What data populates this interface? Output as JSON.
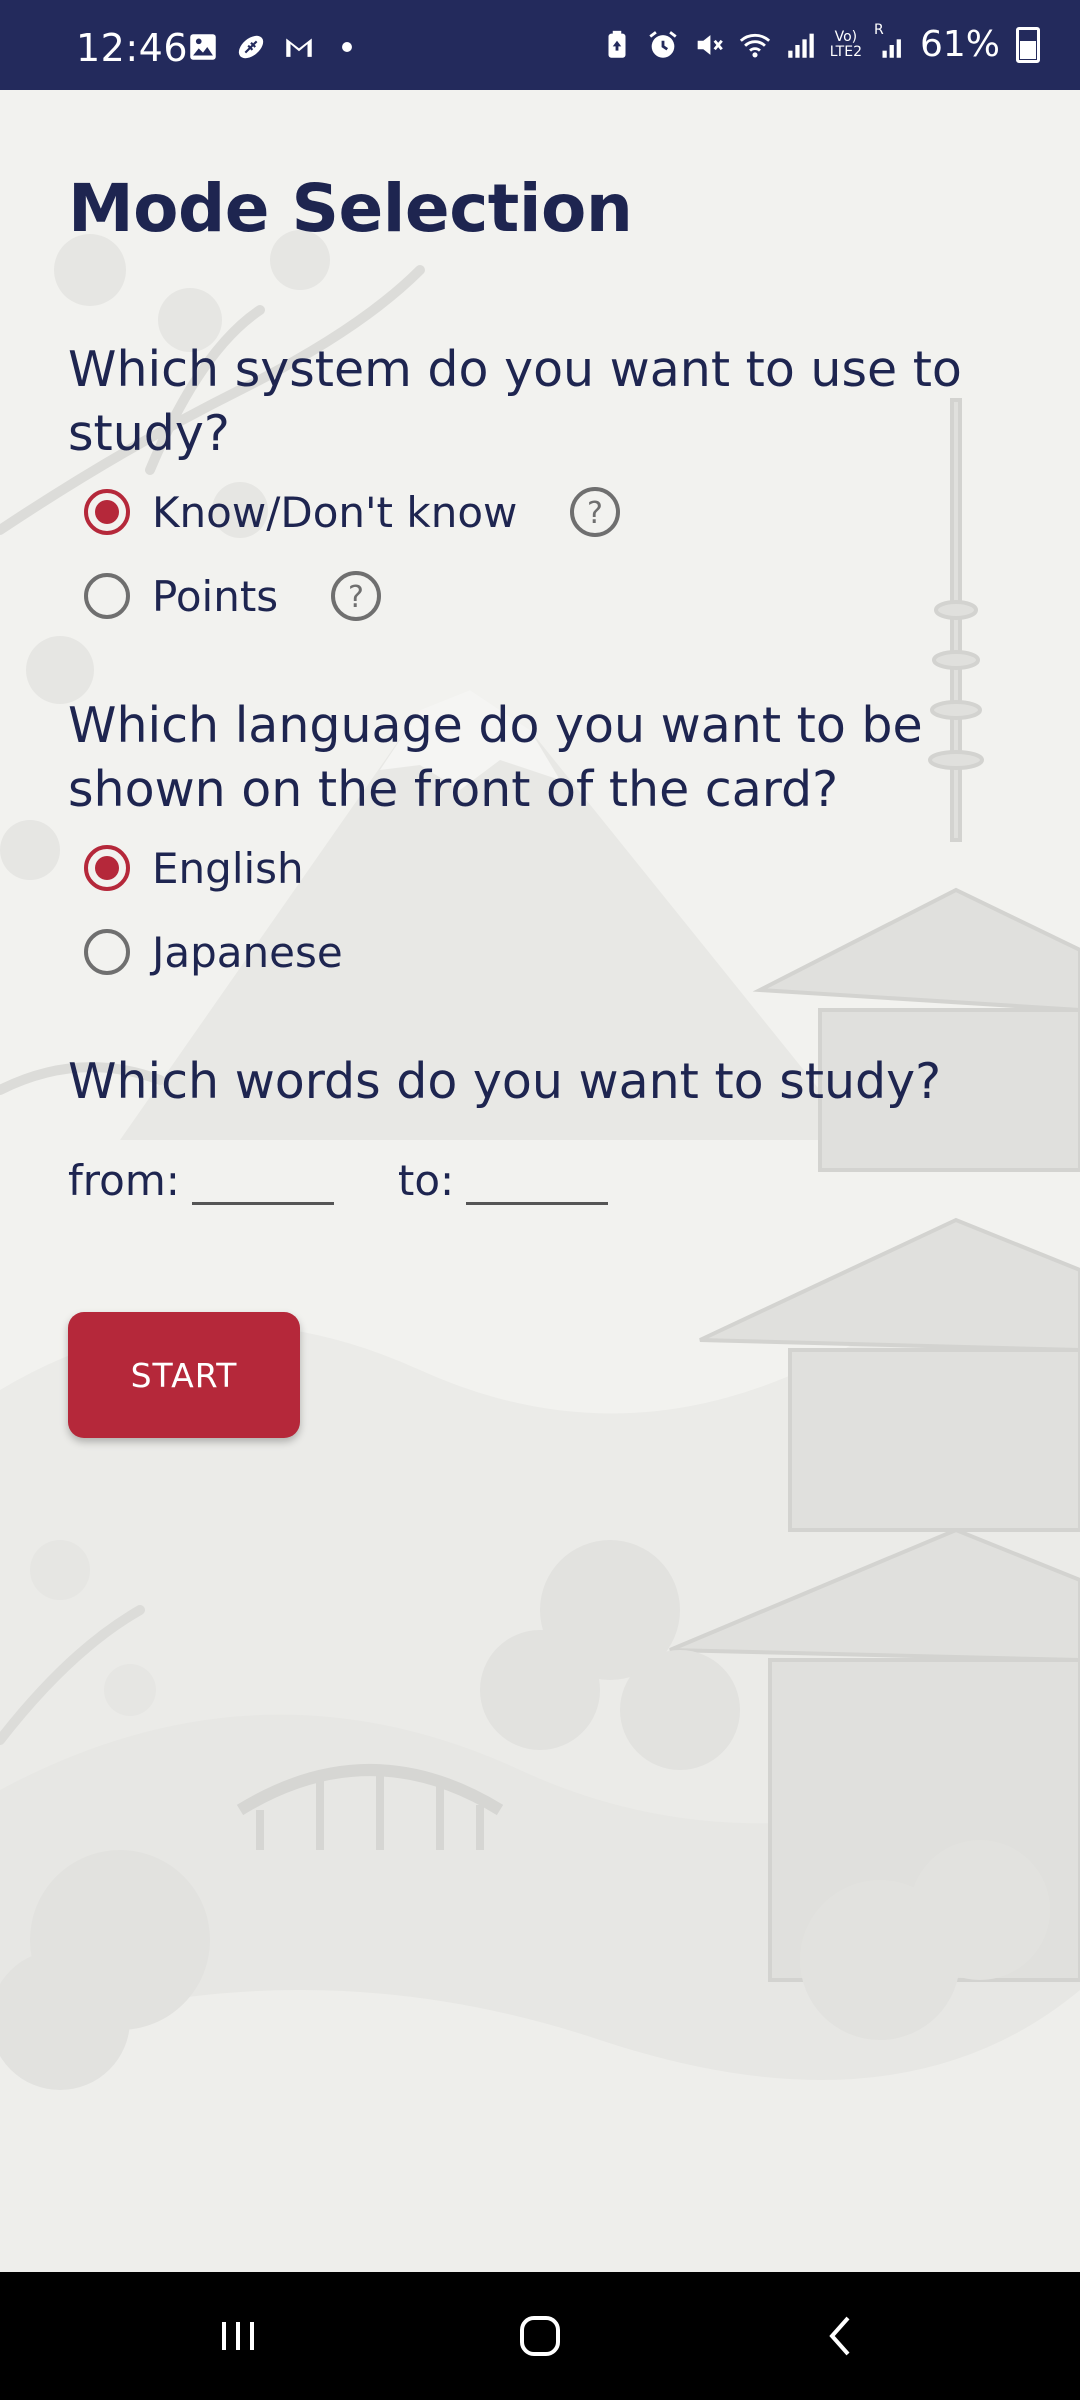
{
  "status_bar": {
    "time": "12:46",
    "battery": "61%",
    "left_icons": [
      "gallery-icon",
      "sports-icon",
      "gmail-icon",
      "dot-icon"
    ],
    "right_icons": [
      "battery-saver-icon",
      "alarm-icon",
      "mute-icon",
      "wifi-icon",
      "signal-icon",
      "volte-icon",
      "signal-roaming-icon"
    ],
    "volte_top": "Vo)",
    "volte_bottom": "LTE2",
    "roaming": "R"
  },
  "page": {
    "title": "Mode Selection"
  },
  "system_section": {
    "question": "Which system do you want to use to study?",
    "options": [
      {
        "label": "Know/Don't know",
        "checked": true
      },
      {
        "label": "Points",
        "checked": false
      }
    ]
  },
  "language_section": {
    "question": "Which language do you want to be shown on the front of the card?",
    "options": [
      {
        "label": "English",
        "checked": true
      },
      {
        "label": "Japanese",
        "checked": false
      }
    ]
  },
  "words_section": {
    "question": "Which words do you want to study?",
    "from_label": "from:",
    "to_label": "to:",
    "from_value": "",
    "to_value": ""
  },
  "start_button": {
    "label": "START"
  },
  "colors": {
    "accent": "#b5283a",
    "text": "#1e2550",
    "status_bar": "#232a5c",
    "background": "#f2f2ef"
  },
  "nav_bar": {
    "icons": [
      "recent-apps-icon",
      "home-icon",
      "back-icon"
    ]
  }
}
